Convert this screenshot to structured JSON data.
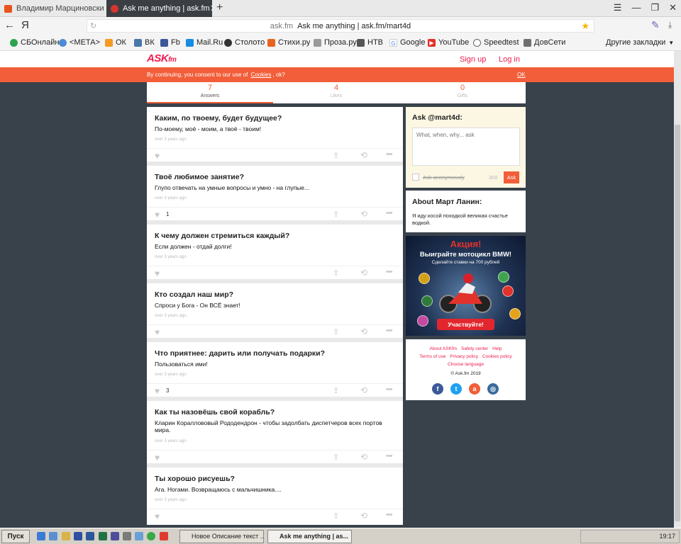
{
  "browser": {
    "tabs": [
      {
        "label": "Владимир Марциновский: к"
      },
      {
        "label": "Ask me anything | ask.fm"
      }
    ],
    "new_tab": "+",
    "back": "←",
    "yandex": "Я",
    "url_host": "ask.fm",
    "url_title": "Ask me anything | ask.fm/mart4d",
    "bookmarks": [
      "СБОнлайн",
      "<МЕТА>",
      "ОК",
      "ВК",
      "Fb",
      "Mail.Ru",
      "Столото",
      "Стихи.ру",
      "Проза.ру",
      "НТВ",
      "Google",
      "YouTube",
      "Speedtest",
      "ДовСети",
      "Другие закладки"
    ]
  },
  "site": {
    "logo": "ASK",
    "logo_suffix": "fm",
    "signup": "Sign up",
    "login": "Log in",
    "cookie_before": "By continuing, you consent to our use of",
    "cookie_link": "Cookies",
    "cookie_after": ", ok?",
    "cookie_ok": "OK"
  },
  "stats": {
    "answers_count": "7",
    "answers_label": "Answers",
    "likes_count": "4",
    "likes_label": "Likes",
    "gifts_count": "0",
    "gifts_label": "Gifts"
  },
  "answers": [
    {
      "question": "Каким, по твоему, будет будущее?",
      "answer": "По-моему, моё - моим, а твоё - твоим!",
      "time": "over 3 years ago",
      "likes": ""
    },
    {
      "question": "Твоё любимое занятие?",
      "answer": "Глупо отвечать на умные вопросы и умно - на глупые...",
      "time": "over 3 years ago",
      "likes": "1"
    },
    {
      "question": "К чему должен стремиться каждый?",
      "answer": "Если должен - отдай долги!",
      "time": "over 3 years ago",
      "likes": ""
    },
    {
      "question": "Кто создал наш мир?",
      "answer": "Спроси у Бога - Он ВСЁ знает!",
      "time": "over 3 years ago",
      "likes": ""
    },
    {
      "question": "Что приятнее: дарить или получать подарки?",
      "answer": "Пользоваться ими!",
      "time": "over 3 years ago",
      "likes": "3"
    },
    {
      "question": "Как ты назовёшь свой корабль?",
      "answer": "Кларин Кораллововый Рододендрон - чтобы задолбать диспетчеров всех портов мира.",
      "time": "over 3 years ago",
      "likes": ""
    },
    {
      "question": "Ты хорошо рисуешь?",
      "answer": "Ага. Ногами. Возвращаюсь с мальчишника....",
      "time": "over 3 years ago",
      "likes": ""
    }
  ],
  "ask": {
    "title": "Ask @mart4d:",
    "placeholder": "What, when, why... ask",
    "anon_label": "Ask anonymously",
    "char_count": "300",
    "button": "Ask"
  },
  "about": {
    "title": "About Март Ланин:",
    "text": "Я иду косой походкой великая счастье водкой."
  },
  "ad": {
    "title": "Акция!",
    "subtitle": "Выиграйте мотоцикл BMW!",
    "small": "Сделайте ставки на 700 рублей",
    "cta": "Участвуйте!"
  },
  "footer": {
    "links_row1": [
      "About ASKfm",
      "Safety center",
      "Help"
    ],
    "links_row2": [
      "Terms of use",
      "Privacy policy",
      "Cookies policy"
    ],
    "links_row3": [
      "Choose language"
    ],
    "copyright": "© Ask.fm 2019"
  },
  "taskbar": {
    "start": "Пуск",
    "task1": "Новое Описание текст ...",
    "task2": "Ask me anything | as...",
    "clock": "19:17"
  },
  "colors": {
    "accent": "#f15e39",
    "brand": "#ee1c4f",
    "background": "#39424b"
  }
}
